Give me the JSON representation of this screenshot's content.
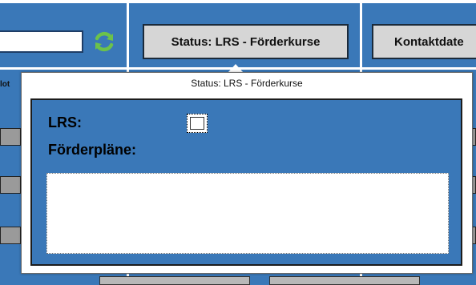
{
  "header": {
    "status_button_label": "Status: LRS - Förderkurse",
    "contact_button_label": "Kontaktdate",
    "search": {
      "value": ""
    },
    "refresh_icon": "refresh-icon"
  },
  "left_partial_label": "lot",
  "popover": {
    "title": "Status: LRS - Förderkurse",
    "lrs_label": "LRS:",
    "lrs_checked": false,
    "foerderplaene_label": "Förderpläne:",
    "foerderplaene_value": ""
  },
  "colors": {
    "background_blue": "#3a78b8",
    "button_gray": "#d6d6d6",
    "refresh_green": "#6cc24a"
  }
}
